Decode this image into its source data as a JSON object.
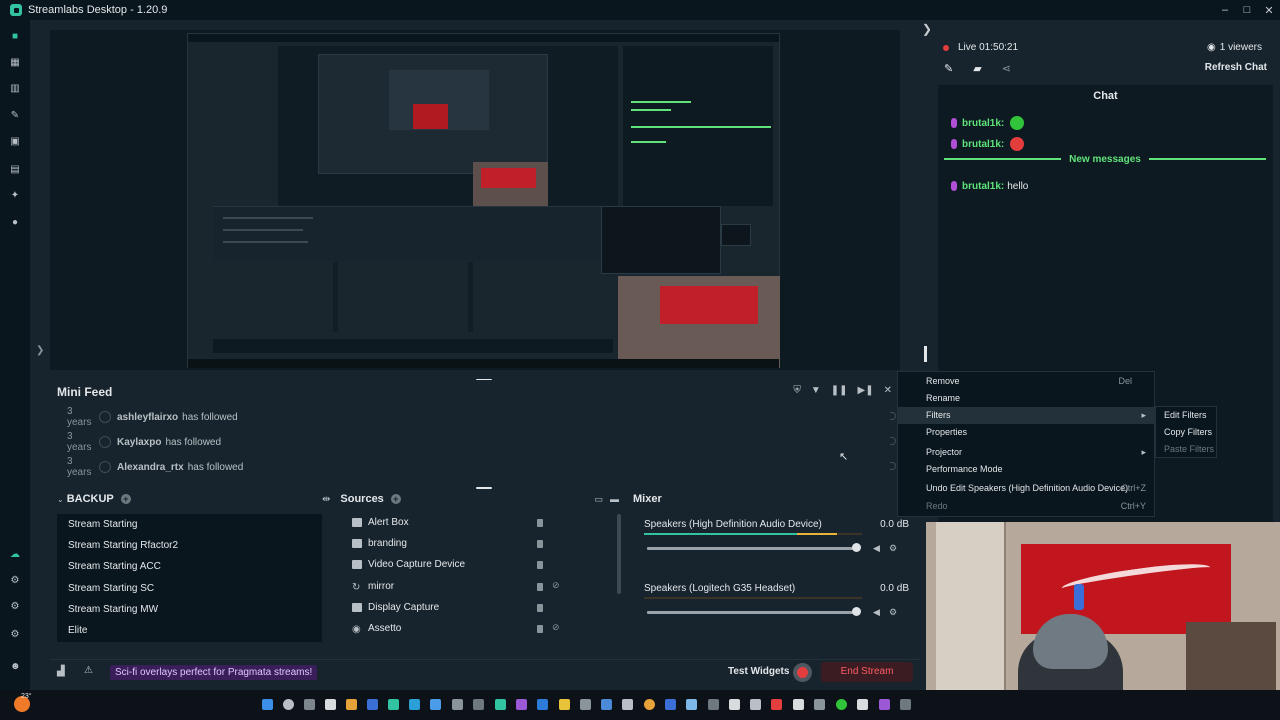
{
  "window": {
    "title": "Streamlabs Desktop - 1.20.9",
    "controls": [
      "–",
      "□",
      "✕"
    ]
  },
  "nav_icons": [
    "studio-icon",
    "dashboard-icon",
    "library-icon",
    "themes-icon",
    "store-icon",
    "layout-icon",
    "alert-icon",
    "record-icon"
  ],
  "nav_icons_bottom": [
    "cloud-icon",
    "settings-icon",
    "gear-icon",
    "gear-icon",
    "user-icon"
  ],
  "mini_feed": {
    "title": "Mini Feed",
    "events": [
      {
        "age": "3 years",
        "name": "ashleyflairxo",
        "action": "has followed"
      },
      {
        "age": "3 years",
        "name": "Kaylaxpo",
        "action": "has followed"
      },
      {
        "age": "3 years",
        "name": "Alexandra_rtx",
        "action": "has followed"
      }
    ]
  },
  "scenes": {
    "title": "BACKUP",
    "items": [
      "Stream Starting",
      "Stream Starting Rfactor2",
      "Stream Starting ACC",
      "Stream Starting SC",
      "Stream Starting MW",
      "Elite"
    ]
  },
  "sources": {
    "title": "Sources",
    "items": [
      "Alert Box",
      "branding",
      "Video Capture Device",
      "mirror",
      "Display Capture",
      "Assetto"
    ]
  },
  "mixer": {
    "title": "Mixer",
    "channels": [
      {
        "name": "Speakers (High Definition Audio Device)",
        "db": "0.0 dB",
        "level": 0.7
      },
      {
        "name": "Speakers (Logitech G35 Headset)",
        "db": "0.0 dB",
        "level": 0.0
      }
    ]
  },
  "footer": {
    "promo": "Sci-fi overlays perfect for Pragmata streams!",
    "test_widgets": "Test Widgets",
    "end_stream": "End Stream"
  },
  "chat_side": {
    "live": "Live 01:50:21",
    "viewers": "1 viewers",
    "refresh": "Refresh Chat",
    "chat_title": "Chat",
    "new_messages": "New messages",
    "messages": [
      {
        "user": "brutal1k:",
        "text": "",
        "emote": "#31c33a"
      },
      {
        "user": "brutal1k:",
        "text": "",
        "emote": "#e33d3d"
      },
      {
        "user": "brutal1k:",
        "text": "hello",
        "emote": ""
      }
    ]
  },
  "context_menu": {
    "items": [
      {
        "label": "Remove",
        "shortcut": "Del"
      },
      {
        "label": "Rename",
        "shortcut": ""
      },
      {
        "label": "Filters",
        "shortcut": ""
      },
      {
        "label": "Properties",
        "shortcut": ""
      },
      {
        "label": "Projector",
        "shortcut": ""
      },
      {
        "label": "Performance Mode",
        "shortcut": ""
      },
      {
        "label": "Undo Edit Speakers (High Definition Audio Device)",
        "shortcut": "Ctrl+Z"
      },
      {
        "label": "Redo",
        "shortcut": "Ctrl+Y"
      }
    ],
    "submenu": [
      "Edit Filters",
      "Copy Filters",
      "Paste Filters"
    ]
  },
  "taskbar": {
    "temp": "23°"
  },
  "colors": {
    "accent": "#31c3a2",
    "chat_green": "#5fe37a",
    "end_stream": "#ff5c64",
    "bg": "#17242d"
  }
}
